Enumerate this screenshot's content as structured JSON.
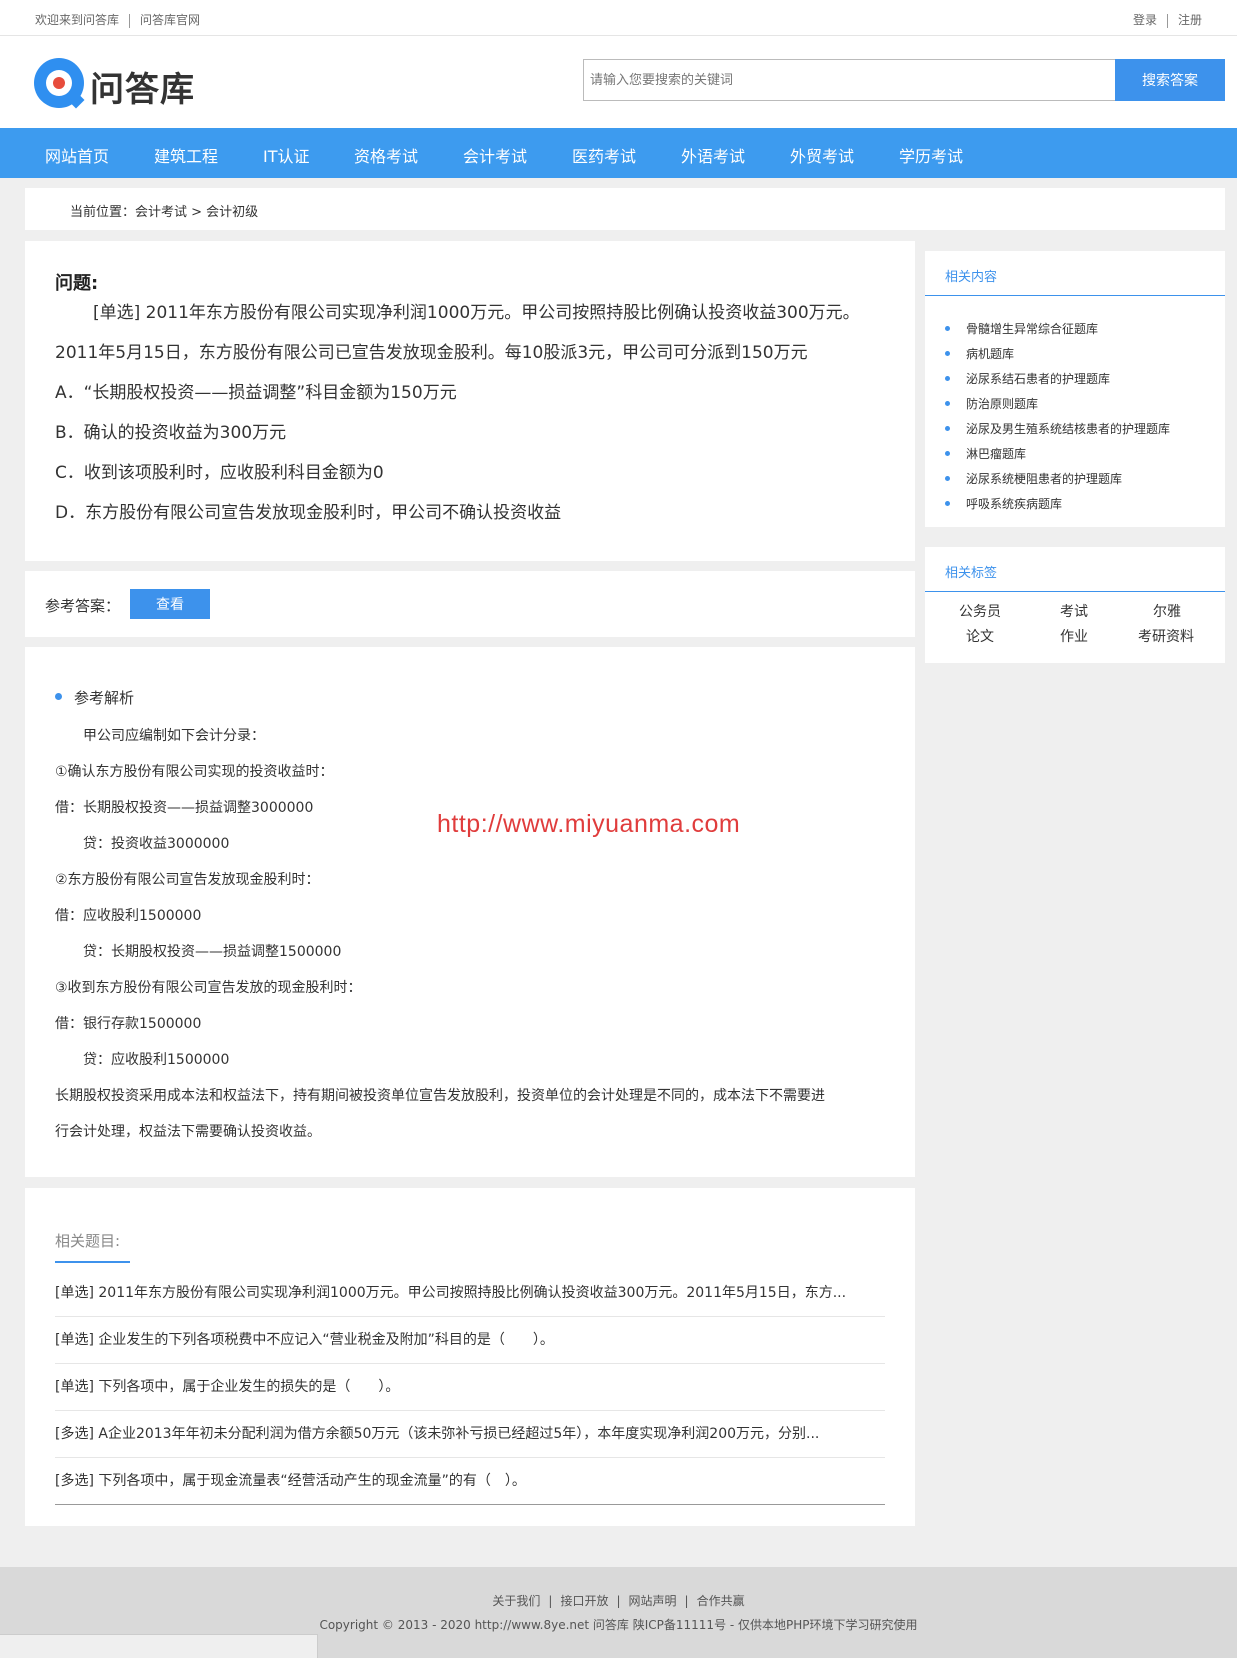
{
  "topbar": {
    "welcome": "欢迎来到问答库",
    "official": "问答库官网",
    "login": "登录",
    "register": "注册"
  },
  "header": {
    "logo_text": "问答库",
    "search_placeholder": "请输入您要搜索的关键词",
    "search_button": "搜索答案"
  },
  "nav": [
    "网站首页",
    "建筑工程",
    "IT认证",
    "资格考试",
    "会计考试",
    "医药考试",
    "外语考试",
    "外贸考试",
    "学历考试"
  ],
  "breadcrumb": "当前位置：会计考试 > 会计初级",
  "question": {
    "title": "问题:",
    "body": "[单选] 2011年东方股份有限公司实现净利润1000万元。甲公司按照持股比例确认投资收益300万元。2011年5月15日，东方股份有限公司已宣告发放现金股利。每10股派3元，甲公司可分派到150万元",
    "options": [
      "A．“长期股权投资——损益调整”科目金额为150万元",
      "B．确认的投资收益为300万元",
      "C．收到该项股利时，应收股利科目金额为0",
      "D．东方股份有限公司宣告发放现金股利时，甲公司不确认投资收益"
    ]
  },
  "answer": {
    "label": "参考答案：",
    "button": "查看"
  },
  "explanation": {
    "heading": "参考解析",
    "lines": [
      "　　甲公司应编制如下会计分录：",
      "①确认东方股份有限公司实现的投资收益时：",
      "借：长期股权投资——损益调整3000000",
      "　　贷：投资收益3000000",
      "②东方股份有限公司宣告发放现金股利时：",
      "借：应收股利1500000",
      "　　贷：长期股权投资——损益调整1500000",
      "③收到东方股份有限公司宣告发放的现金股利时：",
      "借：银行存款1500000",
      "　　贷：应收股利1500000",
      "长期股权投资采用成本法和权益法下，持有期间被投资单位宣告发放股利，投资单位的会计处理是不同的，成本法下不需要进",
      "行会计处理，权益法下需要确认投资收益。"
    ],
    "watermark": "http://www.miyuanma.com"
  },
  "related_questions": {
    "title": "相关题目:",
    "items": [
      "[单选] 2011年东方股份有限公司实现净利润1000万元。甲公司按照持股比例确认投资收益300万元。2011年5月15日，东方...",
      "[单选] 企业发生的下列各项税费中不应记入“营业税金及附加”科目的是（　　）。",
      "[单选] 下列各项中，属于企业发生的损失的是（　　）。",
      "[多选] A企业2013年年初未分配利润为借方余额50万元（该未弥补亏损已经超过5年），本年度实现净利润200万元，分别...",
      "[多选] 下列各项中，属于现金流量表“经营活动产生的现金流量”的有（　）。"
    ]
  },
  "sidebar": {
    "related_title": "相关内容",
    "related_items": [
      "骨髓增生异常综合征题库",
      "病机题库",
      "泌尿系结石患者的护理题库",
      "防治原则题库",
      "泌尿及男生殖系统结核患者的护理题库",
      "淋巴瘤题库",
      "泌尿系统梗阻患者的护理题库",
      "呼吸系统疾病题库"
    ],
    "tags_title": "相关标签",
    "tags": [
      "公务员",
      "考试",
      "尔雅",
      "论文",
      "作业",
      "考研资料"
    ]
  },
  "footer": {
    "links": [
      "关于我们",
      "接口开放",
      "网站声明",
      "合作共赢"
    ],
    "copyright": "Copyright © 2013 - 2020 http://www.8ye.net  问答库   陕ICP备11111号 - 仅供本地PHP环境下学习研究使用"
  },
  "colors": {
    "accent": "#3d92ec",
    "nav_bg": "#3d9bef",
    "watermark": "#e03c3c"
  }
}
